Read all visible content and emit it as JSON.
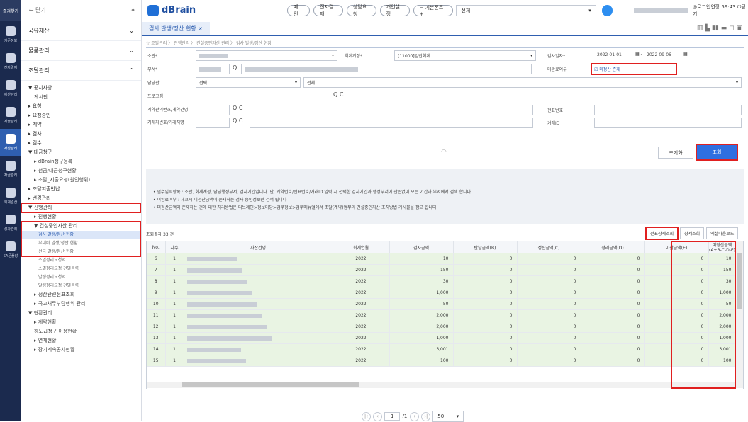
{
  "rail": {
    "top": "즐겨찾기",
    "items": [
      "기준정보",
      "전자결재",
      "예산관리",
      "지출관리",
      "자산관리",
      "자금관리",
      "회계결산",
      "성과관리",
      "SA문플장"
    ]
  },
  "menu": {
    "back": "|← 닫기",
    "cats": [
      "국유재산",
      "물품관리",
      "조달관리"
    ],
    "items": [
      {
        "t": "▼ 공지사항",
        "lv": "l1"
      },
      {
        "t": "게시판",
        "lv": "l2"
      },
      {
        "t": "▸ 요청",
        "lv": "l1"
      },
      {
        "t": "▸ 요청승인",
        "lv": "l1"
      },
      {
        "t": "▸ 계약",
        "lv": "l1"
      },
      {
        "t": "▸ 검사",
        "lv": "l1"
      },
      {
        "t": "▸ 검수",
        "lv": "l1"
      },
      {
        "t": "▼ 대금청구",
        "lv": "l1"
      },
      {
        "t": "▸ dBrain청구등록",
        "lv": "l2"
      },
      {
        "t": "▸ 선금/대금청구현황",
        "lv": "l2"
      },
      {
        "t": "▸ 조달_지출요청(원인행위)",
        "lv": "l2"
      },
      {
        "t": "▸ 조달지출반납",
        "lv": "l1"
      },
      {
        "t": "▸ 변경관리",
        "lv": "l1"
      },
      {
        "t": "▼ 진행관리",
        "lv": "l1"
      },
      {
        "t": "▸ 진행현황",
        "lv": "l2"
      },
      {
        "t": "▼ 건설중인자산 관리",
        "lv": "l2"
      },
      {
        "t": "검사 발생/정산 현황",
        "lv": "l3",
        "sel": true
      },
      {
        "t": "부대비 발생/정산 현황",
        "lv": "l3"
      },
      {
        "t": "선금 발생/정산 현황",
        "lv": "l3"
      },
      {
        "t": "소멸정리요청서",
        "lv": "l3"
      },
      {
        "t": "소멸정리요청 건별목록",
        "lv": "l3"
      },
      {
        "t": "발생정리요청서",
        "lv": "l3"
      },
      {
        "t": "발생정리요청 건별목록",
        "lv": "l3"
      },
      {
        "t": "▸ 정산관련전표조회",
        "lv": "l2"
      },
      {
        "t": "▸ 국고채무부담행위 관리",
        "lv": "l2"
      },
      {
        "t": "▼ 현황관리",
        "lv": "l1"
      },
      {
        "t": "▸ 계약현황",
        "lv": "l2"
      },
      {
        "t": "하도급청구 이용현황",
        "lv": "l2"
      },
      {
        "t": "▸ 연계현황",
        "lv": "l2"
      },
      {
        "t": "▸ 장기계속공사현황",
        "lv": "l2"
      }
    ]
  },
  "top": {
    "logo": "dBrain",
    "pills": [
      "메 인",
      "전자결재",
      "상담요청",
      "개인설정",
      "− 기본폰트 +"
    ],
    "select": "전체",
    "right": "◎로그인연장  59:43  ⏻닫기"
  },
  "tab": {
    "label": "검사 발생/정산 현황  ×",
    "icons": "▥ ▙ ▮▮ ▬ ◻ ▣"
  },
  "crumb": "☆ 조달관리 〉 진행관리 〉 건설중인자산 관리 〉 검사 발생/정산 현황",
  "form": {
    "org": "소관*",
    "account_label": "회계계정*",
    "account_value": "[11000]일반회계",
    "date_label": "검사일자*",
    "date_from": "2022-01-01",
    "date_to": "2022-09-06",
    "dept": "부서*",
    "unsettled_label": "미완료여부",
    "unsettled_value": "☑ 미정산 존재",
    "manager": "담당관",
    "manager_value": "선택",
    "all": "전체",
    "program": "프로그램",
    "contract": "계약관리번호/계약건명",
    "voucher": "전표번호",
    "vendor": "거래처번호/거래처명",
    "trade_id": "거래ID",
    "reset": "초기화",
    "search": "조회"
  },
  "info": [
    "• 필수입력항목 : 소관, 회계계정, 담당행정부서, 검사기간입니다. 단, 계약번호/전표번호/거래ID 입력 시 선택한 검사기간과 행정부서에 관련없이 모든 기간과 부서에서 검색 합니다.",
    "• 미완료여부 : 체크시 미정산금액이 존재하는 검사 승인정보만 검색 됩니다",
    "• 미정산금액이 존재하는 건에 대한 처리방법은 디브레인>정보마당>업무정보>업무매뉴얼에서 조달(계약)업무의 건설중인자산 조치방법 게시물을 참고 합니다."
  ],
  "grid": {
    "count": "조회결과 33 건",
    "buttons": [
      "전표상세조회",
      "상세조회",
      "엑셀다운로드"
    ],
    "headers": [
      "No.",
      "차수",
      "자산건명",
      "회계연월",
      "검사금액",
      "반납금액(B)",
      "정산금액(C)",
      "정리금액(D)",
      "이관금액(E)",
      "미정산금액(A+B-C-D-E)"
    ],
    "rows": [
      [
        "6",
        "1",
        "2022",
        "10",
        "0",
        "0",
        "0",
        "0",
        "10"
      ],
      [
        "7",
        "1",
        "2022",
        "150",
        "0",
        "0",
        "0",
        "0",
        "150"
      ],
      [
        "8",
        "1",
        "2022",
        "30",
        "0",
        "0",
        "0",
        "0",
        "30"
      ],
      [
        "9",
        "1",
        "2022",
        "1,000",
        "0",
        "0",
        "0",
        "0",
        "1,000"
      ],
      [
        "10",
        "1",
        "2022",
        "50",
        "0",
        "0",
        "0",
        "0",
        "50"
      ],
      [
        "11",
        "1",
        "2022",
        "2,000",
        "0",
        "0",
        "0",
        "0",
        "2,000"
      ],
      [
        "12",
        "1",
        "2022",
        "2,000",
        "0",
        "0",
        "0",
        "0",
        "2,000"
      ],
      [
        "13",
        "1",
        "2022",
        "1,000",
        "0",
        "0",
        "0",
        "0",
        "1,000"
      ],
      [
        "14",
        "1",
        "2022",
        "3,001",
        "0",
        "0",
        "0",
        "0",
        "3,001"
      ],
      [
        "15",
        "1",
        "2022",
        "100",
        "0",
        "0",
        "0",
        "0",
        "100"
      ]
    ]
  },
  "pager": {
    "page": "1",
    "total": "/1",
    "size": "50"
  }
}
